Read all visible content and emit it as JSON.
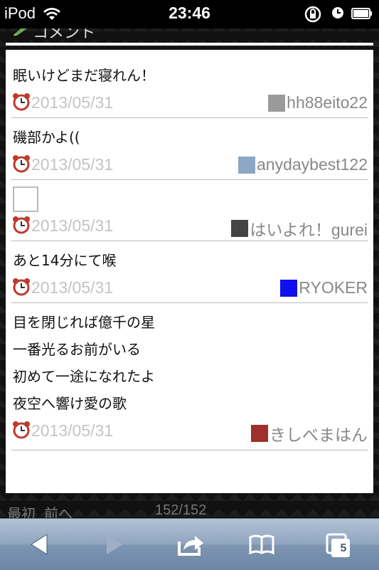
{
  "status_bar": {
    "carrier": "iPod",
    "time": "23:46"
  },
  "section": {
    "title": "コメント"
  },
  "comments": [
    {
      "lines": [
        "眠いけどまだ寝れん！"
      ],
      "date": "2013/05/31",
      "user": "hh88eito22",
      "avatar_color": "#9a9a9a"
    },
    {
      "lines": [
        "磯部かよ(("
      ],
      "date": "2013/05/31",
      "user": "anydaybest122",
      "avatar_color": "#8aa7c4"
    },
    {
      "lines": [],
      "date": "2013/05/31",
      "user": "はいよれ！gurei",
      "avatar_color": "#444444"
    },
    {
      "lines": [
        "あと14分にて喉"
      ],
      "date": "2013/05/31",
      "user": "RYOKER",
      "avatar_color": "#1010ee"
    },
    {
      "lines": [
        "目を閉じれば億千の星",
        "一番光るお前がいる",
        "初めて一途になれたよ",
        "夜空へ響け愛の歌"
      ],
      "date": "2013/05/31",
      "user": "きしべまはん",
      "avatar_color": "#a0302a"
    }
  ],
  "pager": {
    "first": "最初",
    "prev": "前へ",
    "count": "152/152"
  },
  "toolbar": {
    "tabs_count": "5"
  }
}
